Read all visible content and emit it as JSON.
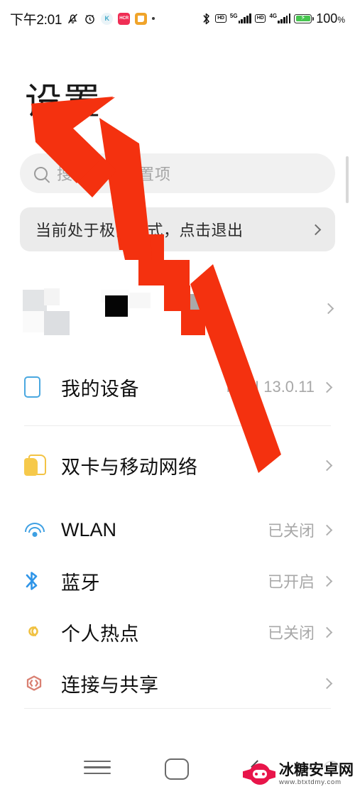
{
  "status_bar": {
    "clock": "下午2:01",
    "battery_percent": "100",
    "percent_symbol": "%",
    "icons": [
      "mute-bell-icon",
      "alarm-clock-icon",
      "kugou-app-icon",
      "red-app-icon",
      "orange-app-icon",
      "more-dot-icon",
      "bluetooth-icon",
      "hd-volte-icon",
      "signal-5g-icon",
      "hd-volte-icon-2",
      "signal-4g-icon",
      "battery-charging-icon"
    ],
    "badge_labels": {
      "kugou": "K",
      "red": "HCR",
      "orange": ""
    },
    "network": {
      "sim1_label": "5G",
      "sim2_label": "4G",
      "hd_label": "HD"
    }
  },
  "header": {
    "title": "设置"
  },
  "search": {
    "placeholder": "搜索系统设置项",
    "icon": "search-icon"
  },
  "banner": {
    "text": "当前处于极简模式，点击退出",
    "chevron": "chevron-right-icon"
  },
  "account": {
    "redacted": true,
    "chevron": "chevron-right-icon"
  },
  "list": {
    "items": [
      {
        "label": "我的设备",
        "value": "MIUI 13.0.11",
        "icon": "phone-icon",
        "icon_color": "#4aa8e0",
        "divider": true
      },
      {
        "label": "双卡与移动网络",
        "value": "",
        "icon": "sim-card-icon",
        "icon_color": "#f6c94b",
        "divider": false
      },
      {
        "label": "WLAN",
        "value": "已关闭",
        "icon": "wifi-icon",
        "icon_color": "#3ea0e3",
        "divider": false
      },
      {
        "label": "蓝牙",
        "value": "已开启",
        "icon": "bluetooth-icon",
        "icon_color": "#2f95e8",
        "divider": false
      },
      {
        "label": "个人热点",
        "value": "已关闭",
        "icon": "hotspot-icon",
        "icon_color": "#f0c141",
        "divider": false
      },
      {
        "label": "连接与共享",
        "value": "",
        "icon": "connection-sharing-icon",
        "icon_color": "#d98072",
        "divider": true
      }
    ]
  },
  "nav_bar": {
    "recent_label": "recent-apps-icon",
    "home_label": "home-icon",
    "back_label": "back-icon"
  },
  "watermark": {
    "site_name": "冰糖安卓网",
    "url": "www.btxtdmy.com",
    "logo": "candy-gamepad-logo"
  },
  "overlay": {
    "annotation": "red-arrow-pointing-to-settings-title",
    "color": "#f4310f"
  },
  "colors": {
    "background": "#ffffff",
    "search_field": "#f1f1f1",
    "banner_field": "#ebebeb",
    "text_primary": "#0f0f0f",
    "text_secondary": "#a8a8a8",
    "accent_red": "#f4310f",
    "battery_green": "#46c54f"
  }
}
